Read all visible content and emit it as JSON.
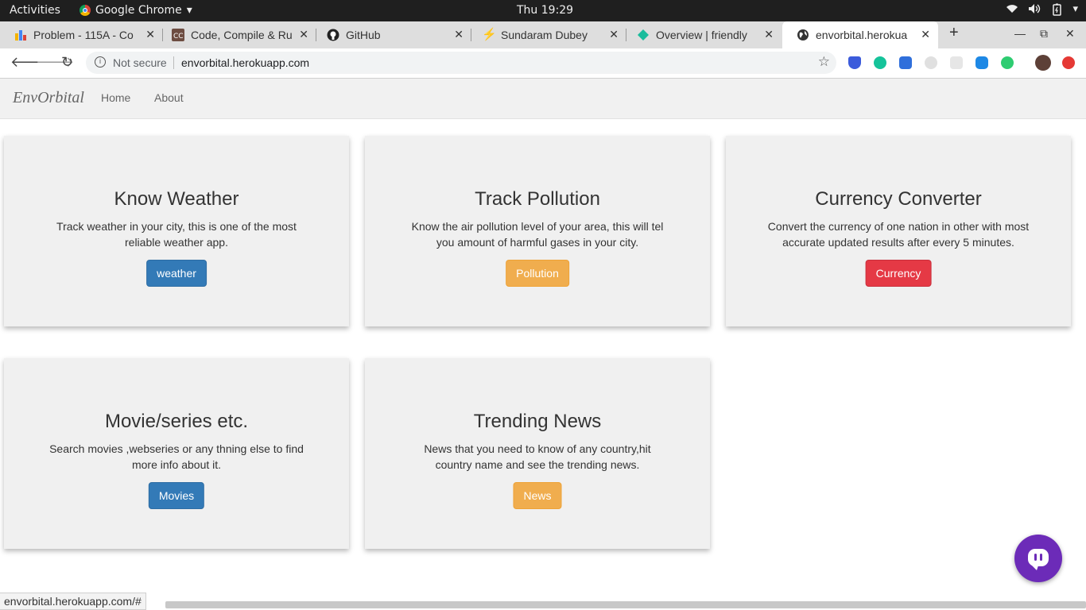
{
  "os_bar": {
    "activities": "Activities",
    "app_name": "Google Chrome",
    "clock": "Thu 19:29"
  },
  "browser": {
    "tabs": [
      {
        "title": "Problem - 115A - Co",
        "favicon": "bar-chart-icon"
      },
      {
        "title": "Code, Compile & Ru",
        "favicon": "cc-icon"
      },
      {
        "title": "GitHub",
        "favicon": "github-icon"
      },
      {
        "title": "Sundaram Dubey",
        "favicon": "lightning-icon"
      },
      {
        "title": "Overview | friendly",
        "favicon": "diamond-icon"
      },
      {
        "title": "envorbital.herokua",
        "favicon": "globe-icon",
        "active": true
      }
    ],
    "address": {
      "security": "Not secure",
      "url": "envorbital.herokuapp.com"
    },
    "status_url": "envorbital.herokuapp.com/#"
  },
  "site": {
    "brand": "EnvOrbital",
    "nav": [
      "Home",
      "About"
    ],
    "cards": [
      {
        "title": "Know Weather",
        "desc_line1": "Track weather in your city, this is one of the most",
        "desc_line2": "reliable weather app.",
        "button": "weather",
        "button_color": "#337ab7"
      },
      {
        "title": "Track Pollution",
        "desc_line1": "Know the air pollution level of your area, this will tel",
        "desc_line2": "you amount of harmful gases in your city.",
        "button": "Pollution",
        "button_color": "#f0ad4e"
      },
      {
        "title": "Currency Converter",
        "desc_line1": "Convert the currency of one nation in other with most",
        "desc_line2": "accurate updated results after every 5 minutes.",
        "button": "Currency",
        "button_color": "#e53945"
      },
      {
        "title": "Movie/series etc.",
        "desc_line1": "Search movies ,webseries or any thning else to find",
        "desc_line2": "more info about it.",
        "button": "Movies",
        "button_color": "#337ab7"
      },
      {
        "title": "Trending News",
        "desc_line1": "News that you need to know of any country,hit",
        "desc_line2": "country name and see the trending news.",
        "button": "News",
        "button_color": "#f0ad4e"
      }
    ]
  },
  "colors": {
    "chat_accent": "#6c2bb8"
  }
}
